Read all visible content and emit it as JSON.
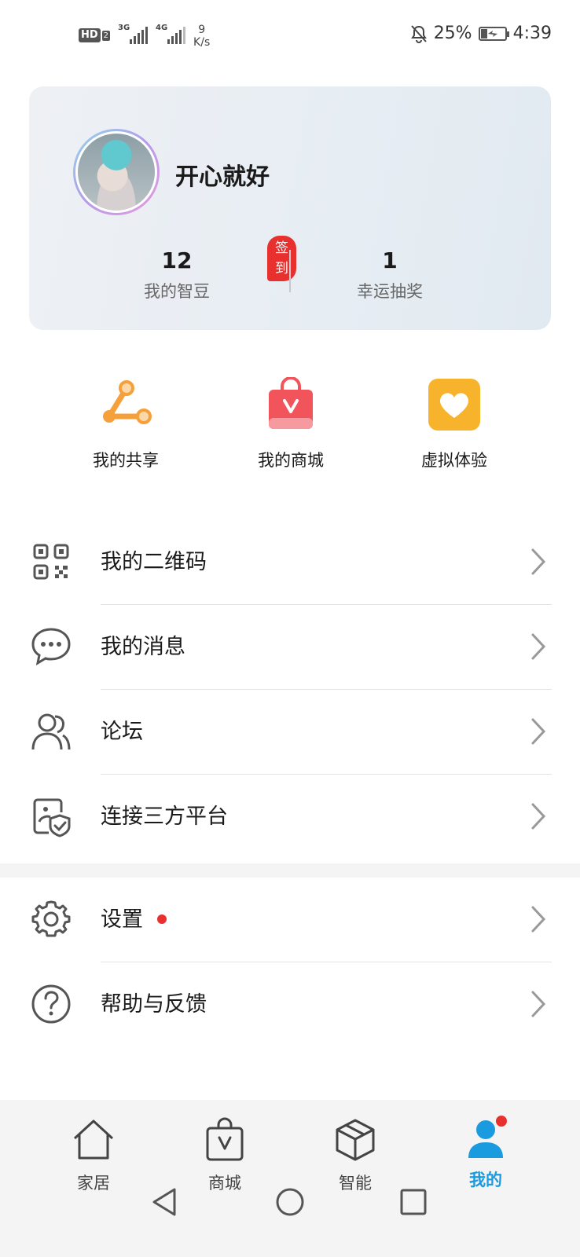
{
  "status_bar": {
    "hd_label": "HD",
    "hd_sub": "2",
    "sim1_type": "3G",
    "sim2_type": "4G",
    "speed_value": "9",
    "speed_unit": "K/s",
    "battery_percent": "25%",
    "time": "4:39"
  },
  "profile": {
    "username": "开心就好",
    "beans_count": "12",
    "beans_label": "我的智豆",
    "signin_badge": "签到",
    "lottery_count": "1",
    "lottery_label": "幸运抽奖"
  },
  "quick_actions": [
    {
      "label": "我的共享",
      "icon": "share-nodes-icon",
      "color": "#f5a03a"
    },
    {
      "label": "我的商城",
      "icon": "shopping-bag-icon",
      "color": "#f2545b"
    },
    {
      "label": "虚拟体验",
      "icon": "heart-icon",
      "color": "#f7b32b"
    }
  ],
  "menu": [
    {
      "label": "我的二维码",
      "icon": "qr-code-icon"
    },
    {
      "label": "我的消息",
      "icon": "chat-bubble-icon"
    },
    {
      "label": "论坛",
      "icon": "people-icon"
    },
    {
      "label": "连接三方平台",
      "icon": "shield-link-icon"
    },
    {
      "label": "设置",
      "icon": "gear-icon",
      "has_dot": true
    },
    {
      "label": "帮助与反馈",
      "icon": "help-icon"
    }
  ],
  "bottom_nav": [
    {
      "label": "家居",
      "icon": "home-icon",
      "active": false
    },
    {
      "label": "商城",
      "icon": "store-bag-icon",
      "active": false
    },
    {
      "label": "智能",
      "icon": "cube-icon",
      "active": false
    },
    {
      "label": "我的",
      "icon": "person-icon",
      "active": true
    }
  ],
  "colors": {
    "accent": "#1a9be0",
    "badge_red": "#e8302e"
  }
}
